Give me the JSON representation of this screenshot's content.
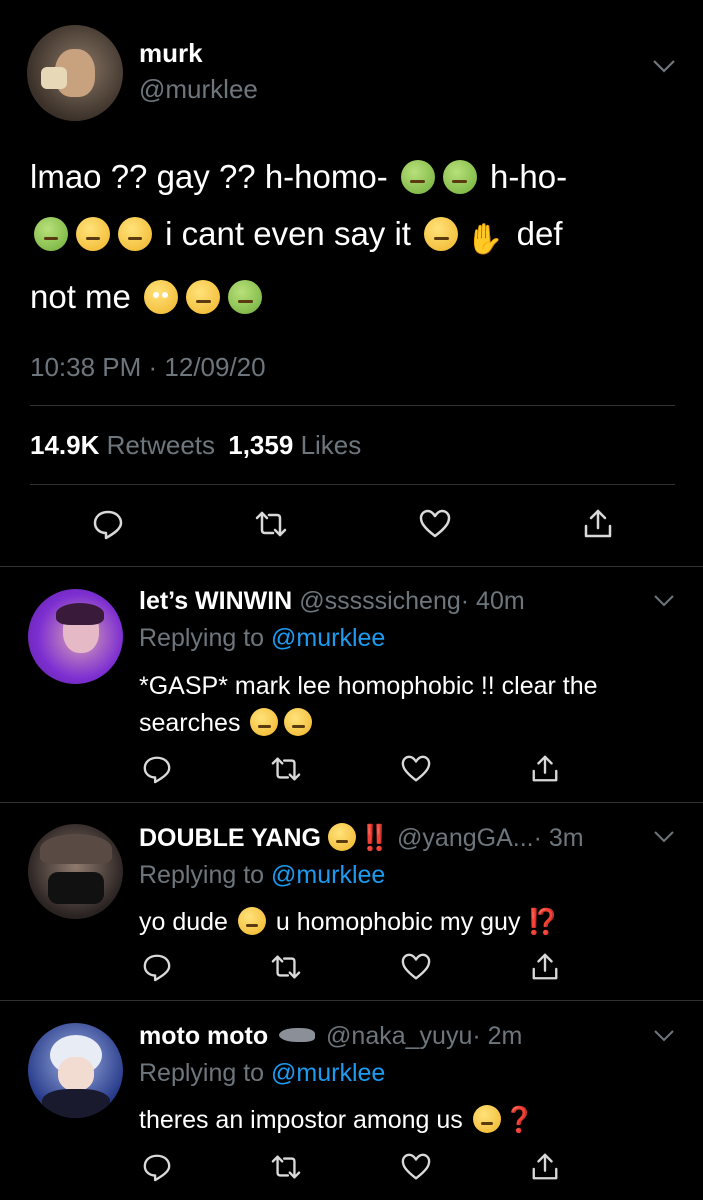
{
  "main_tweet": {
    "display_name": "murk",
    "handle": "@murklee",
    "text_line1_a": "lmao ?? gay ?? h-homo-",
    "text_line1_b": "h-ho-",
    "text_line2_a": "i cant even say it",
    "text_line2_b": "def",
    "text_line3_a": "not me",
    "timestamp": "10:38 PM · 12/09/20",
    "retweets_count": "14.9K",
    "retweets_label": "Retweets",
    "likes_count": "1,359",
    "likes_label": "Likes"
  },
  "replies": [
    {
      "display_name": "let’s WINWIN",
      "handle": "@sssssicheng",
      "time": "· 40m",
      "replying_prefix": "Replying to",
      "replying_handle": "@murklee",
      "text_line1": "*GASP* mark lee homophobic !! clear the",
      "text_line2": "searches",
      "avatar_color": "#8a3fd9"
    },
    {
      "display_name": "DOUBLE YANG",
      "badge_text": "‼️",
      "handle": "@yangGA...",
      "time": "· 3m",
      "replying_prefix": "Replying to",
      "replying_handle": "@murklee",
      "text_a": "yo dude",
      "text_b": "u homophobic my guy",
      "text_c": "⁉️",
      "avatar_color": "#3a3a3a"
    },
    {
      "display_name": "moto moto",
      "handle": "@naka_yuyu",
      "time": "· 2m",
      "replying_prefix": "Replying to",
      "replying_handle": "@murklee",
      "text_a": "theres an impostor among us",
      "text_b": "❓",
      "avatar_color": "#2a3f8f"
    }
  ],
  "icons": [
    "chevron-down-icon",
    "reply-icon",
    "retweet-icon",
    "like-icon",
    "share-icon"
  ],
  "colors": {
    "background": "#000000",
    "secondary_text": "#6e767d",
    "link": "#1d9bf0",
    "divider": "#2f3336"
  }
}
